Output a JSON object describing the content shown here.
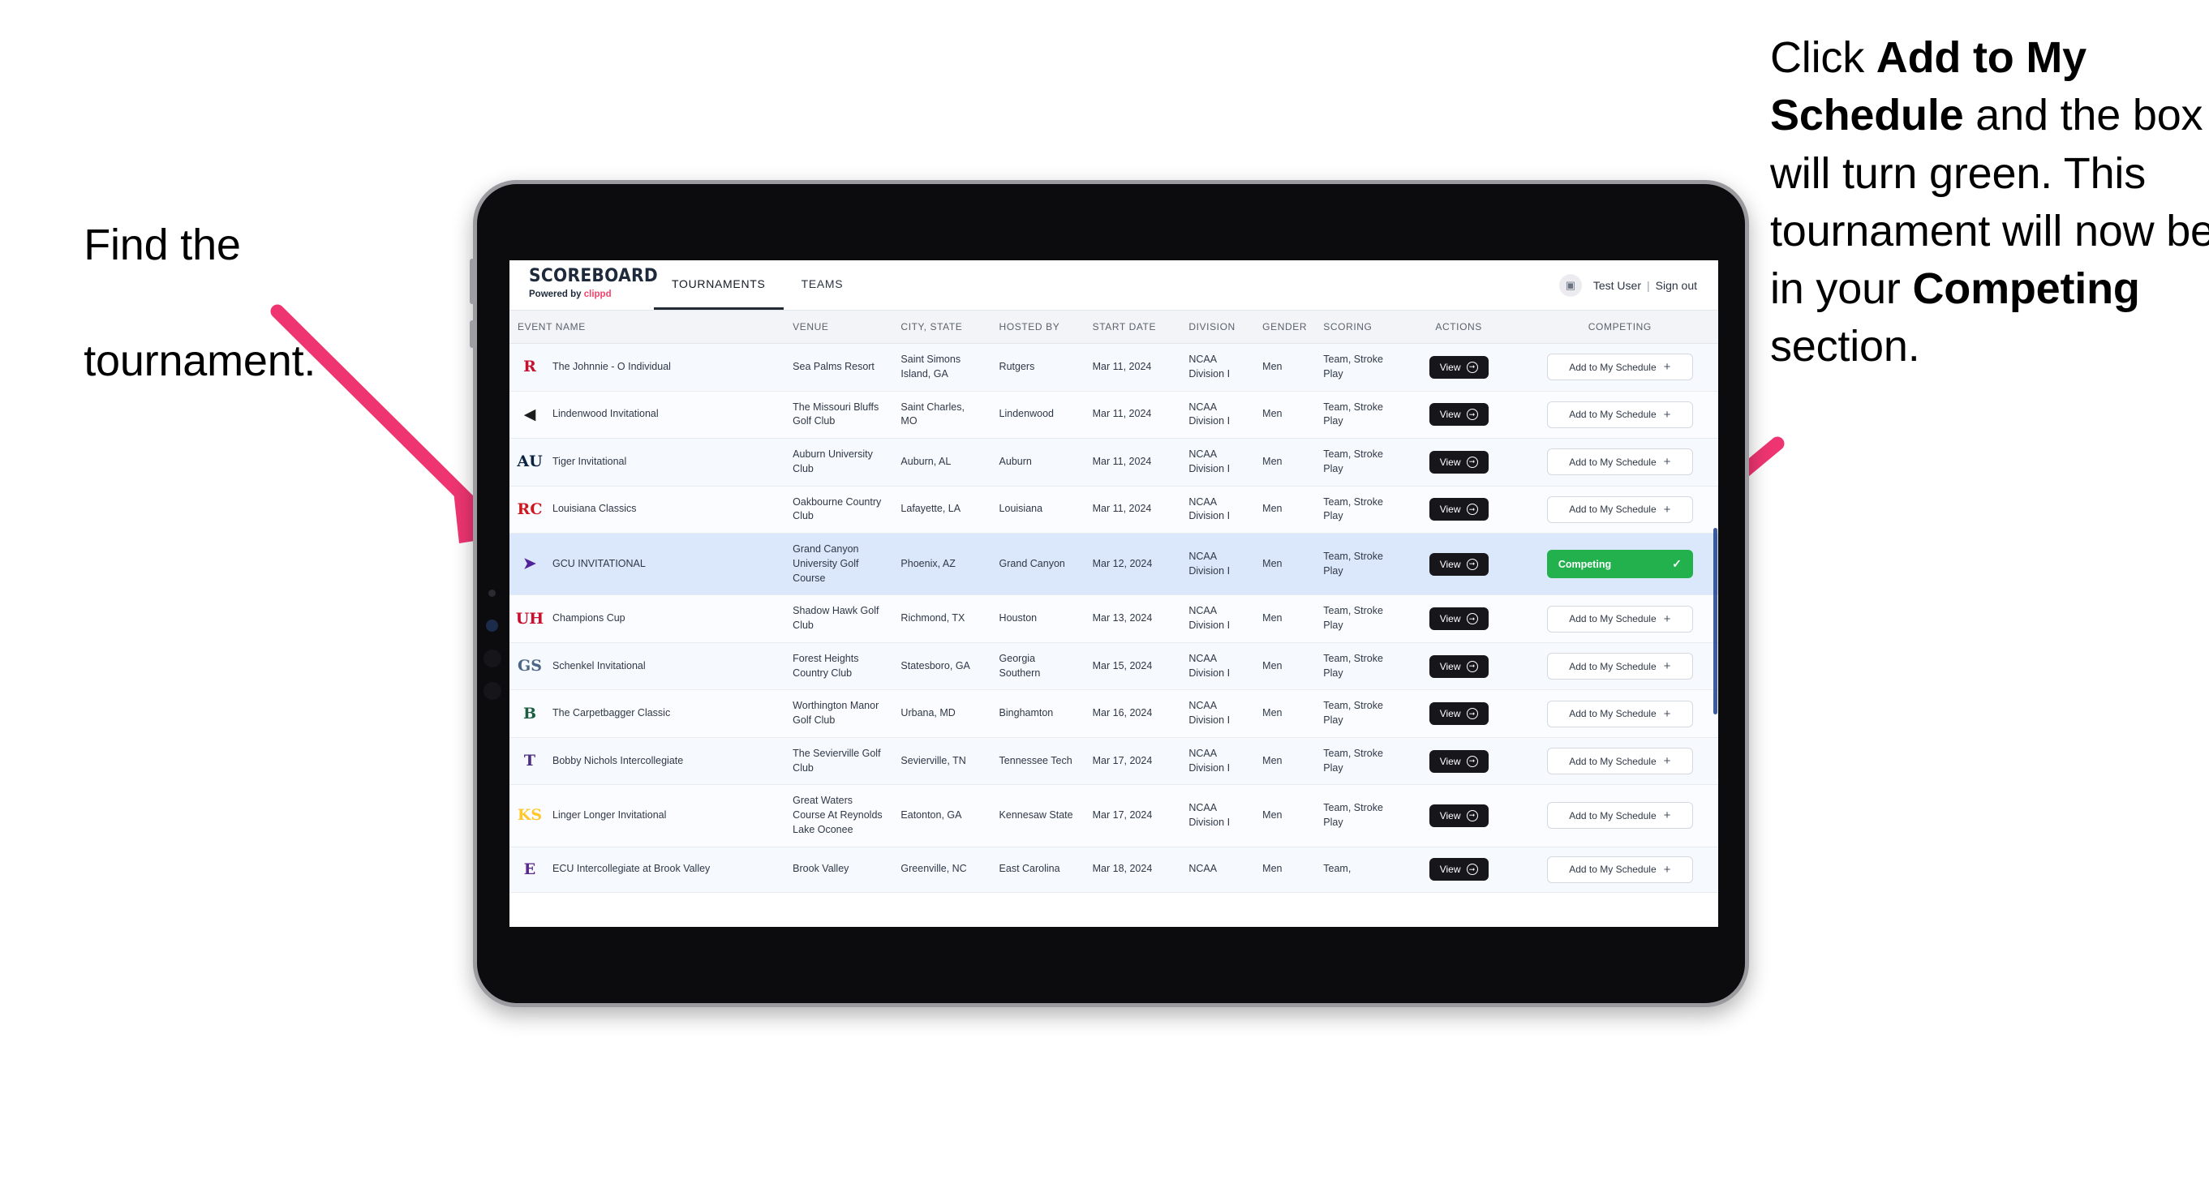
{
  "annotations": {
    "left": {
      "line1": "Find the",
      "line2": "tournament."
    },
    "right": {
      "seg1": "Click ",
      "bold1": "Add to My Schedule",
      "seg2": " and the box will turn green. This tournament will now be in your ",
      "bold2": "Competing",
      "seg3": " section."
    },
    "arrow_color": "#ee3572"
  },
  "app": {
    "brand": {
      "title": "SCOREBOARD",
      "powered_prefix": "Powered by ",
      "powered_brand": "clippd",
      "brand_color": "#f4436c"
    },
    "nav": [
      {
        "label": "TOURNAMENTS",
        "active": true
      },
      {
        "label": "TEAMS",
        "active": false
      }
    ],
    "user": {
      "avatar_icon": "user-avatar-icon",
      "name": "Test User",
      "separator": "|",
      "signout": "Sign out"
    }
  },
  "table": {
    "columns": [
      "EVENT NAME",
      "VENUE",
      "CITY, STATE",
      "HOSTED BY",
      "START DATE",
      "DIVISION",
      "GENDER",
      "SCORING",
      "ACTIONS",
      "COMPETING"
    ],
    "buttons": {
      "view": "View",
      "view_icon": "arrow-right-circle-icon",
      "add": "Add to My Schedule",
      "add_icon": "plus-icon",
      "competing": "Competing",
      "competing_icon": "check-icon"
    },
    "rows": [
      {
        "logo_text": "R",
        "logo_color": "#c8102e",
        "event": "The Johnnie - O Individual",
        "venue": "Sea Palms Resort",
        "city": "Saint Simons Island, GA",
        "hosted_by": "Rutgers",
        "start_date": "Mar 11, 2024",
        "division": "NCAA Division I",
        "gender": "Men",
        "scoring": "Team, Stroke Play",
        "competing": false
      },
      {
        "logo_text": "◀",
        "logo_color": "#1c1c1c",
        "event": "Lindenwood Invitational",
        "venue": "The Missouri Bluffs Golf Club",
        "city": "Saint Charles, MO",
        "hosted_by": "Lindenwood",
        "start_date": "Mar 11, 2024",
        "division": "NCAA Division I",
        "gender": "Men",
        "scoring": "Team, Stroke Play",
        "competing": false
      },
      {
        "logo_text": "AU",
        "logo_color": "#0c2340",
        "event": "Tiger Invitational",
        "venue": "Auburn University Club",
        "city": "Auburn, AL",
        "hosted_by": "Auburn",
        "start_date": "Mar 11, 2024",
        "division": "NCAA Division I",
        "gender": "Men",
        "scoring": "Team, Stroke Play",
        "competing": false
      },
      {
        "logo_text": "RC",
        "logo_color": "#ce181e",
        "event": "Louisiana Classics",
        "venue": "Oakbourne Country Club",
        "city": "Lafayette, LA",
        "hosted_by": "Louisiana",
        "start_date": "Mar 11, 2024",
        "division": "NCAA Division I",
        "gender": "Men",
        "scoring": "Team, Stroke Play",
        "competing": false
      },
      {
        "logo_text": "➤",
        "logo_color": "#522398",
        "event": "GCU INVITATIONAL",
        "venue": "Grand Canyon University Golf Course",
        "city": "Phoenix, AZ",
        "hosted_by": "Grand Canyon",
        "start_date": "Mar 12, 2024",
        "division": "NCAA Division I",
        "gender": "Men",
        "scoring": "Team, Stroke Play",
        "competing": true,
        "selected": true
      },
      {
        "logo_text": "UH",
        "logo_color": "#c8102e",
        "event": "Champions Cup",
        "venue": "Shadow Hawk Golf Club",
        "city": "Richmond, TX",
        "hosted_by": "Houston",
        "start_date": "Mar 13, 2024",
        "division": "NCAA Division I",
        "gender": "Men",
        "scoring": "Team, Stroke Play",
        "competing": false
      },
      {
        "logo_text": "GS",
        "logo_color": "#4a6585",
        "event": "Schenkel Invitational",
        "venue": "Forest Heights Country Club",
        "city": "Statesboro, GA",
        "hosted_by": "Georgia Southern",
        "start_date": "Mar 15, 2024",
        "division": "NCAA Division I",
        "gender": "Men",
        "scoring": "Team, Stroke Play",
        "competing": false
      },
      {
        "logo_text": "B",
        "logo_color": "#1b5e41",
        "event": "The Carpetbagger Classic",
        "venue": "Worthington Manor Golf Club",
        "city": "Urbana, MD",
        "hosted_by": "Binghamton",
        "start_date": "Mar 16, 2024",
        "division": "NCAA Division I",
        "gender": "Men",
        "scoring": "Team, Stroke Play",
        "competing": false
      },
      {
        "logo_text": "T",
        "logo_color": "#4b2e83",
        "event": "Bobby Nichols Intercollegiate",
        "venue": "The Sevierville Golf Club",
        "city": "Sevierville, TN",
        "hosted_by": "Tennessee Tech",
        "start_date": "Mar 17, 2024",
        "division": "NCAA Division I",
        "gender": "Men",
        "scoring": "Team, Stroke Play",
        "competing": false
      },
      {
        "logo_text": "KS",
        "logo_color": "#ffc72c",
        "event": "Linger Longer Invitational",
        "venue": "Great Waters Course At Reynolds Lake Oconee",
        "city": "Eatonton, GA",
        "hosted_by": "Kennesaw State",
        "start_date": "Mar 17, 2024",
        "division": "NCAA Division I",
        "gender": "Men",
        "scoring": "Team, Stroke Play",
        "competing": false
      },
      {
        "logo_text": "E",
        "logo_color": "#592a8a",
        "event": "ECU Intercollegiate at Brook Valley",
        "venue": "Brook Valley",
        "city": "Greenville, NC",
        "hosted_by": "East Carolina",
        "start_date": "Mar 18, 2024",
        "division": "NCAA",
        "gender": "Men",
        "scoring": "Team,",
        "competing": false,
        "partial": true
      }
    ]
  }
}
